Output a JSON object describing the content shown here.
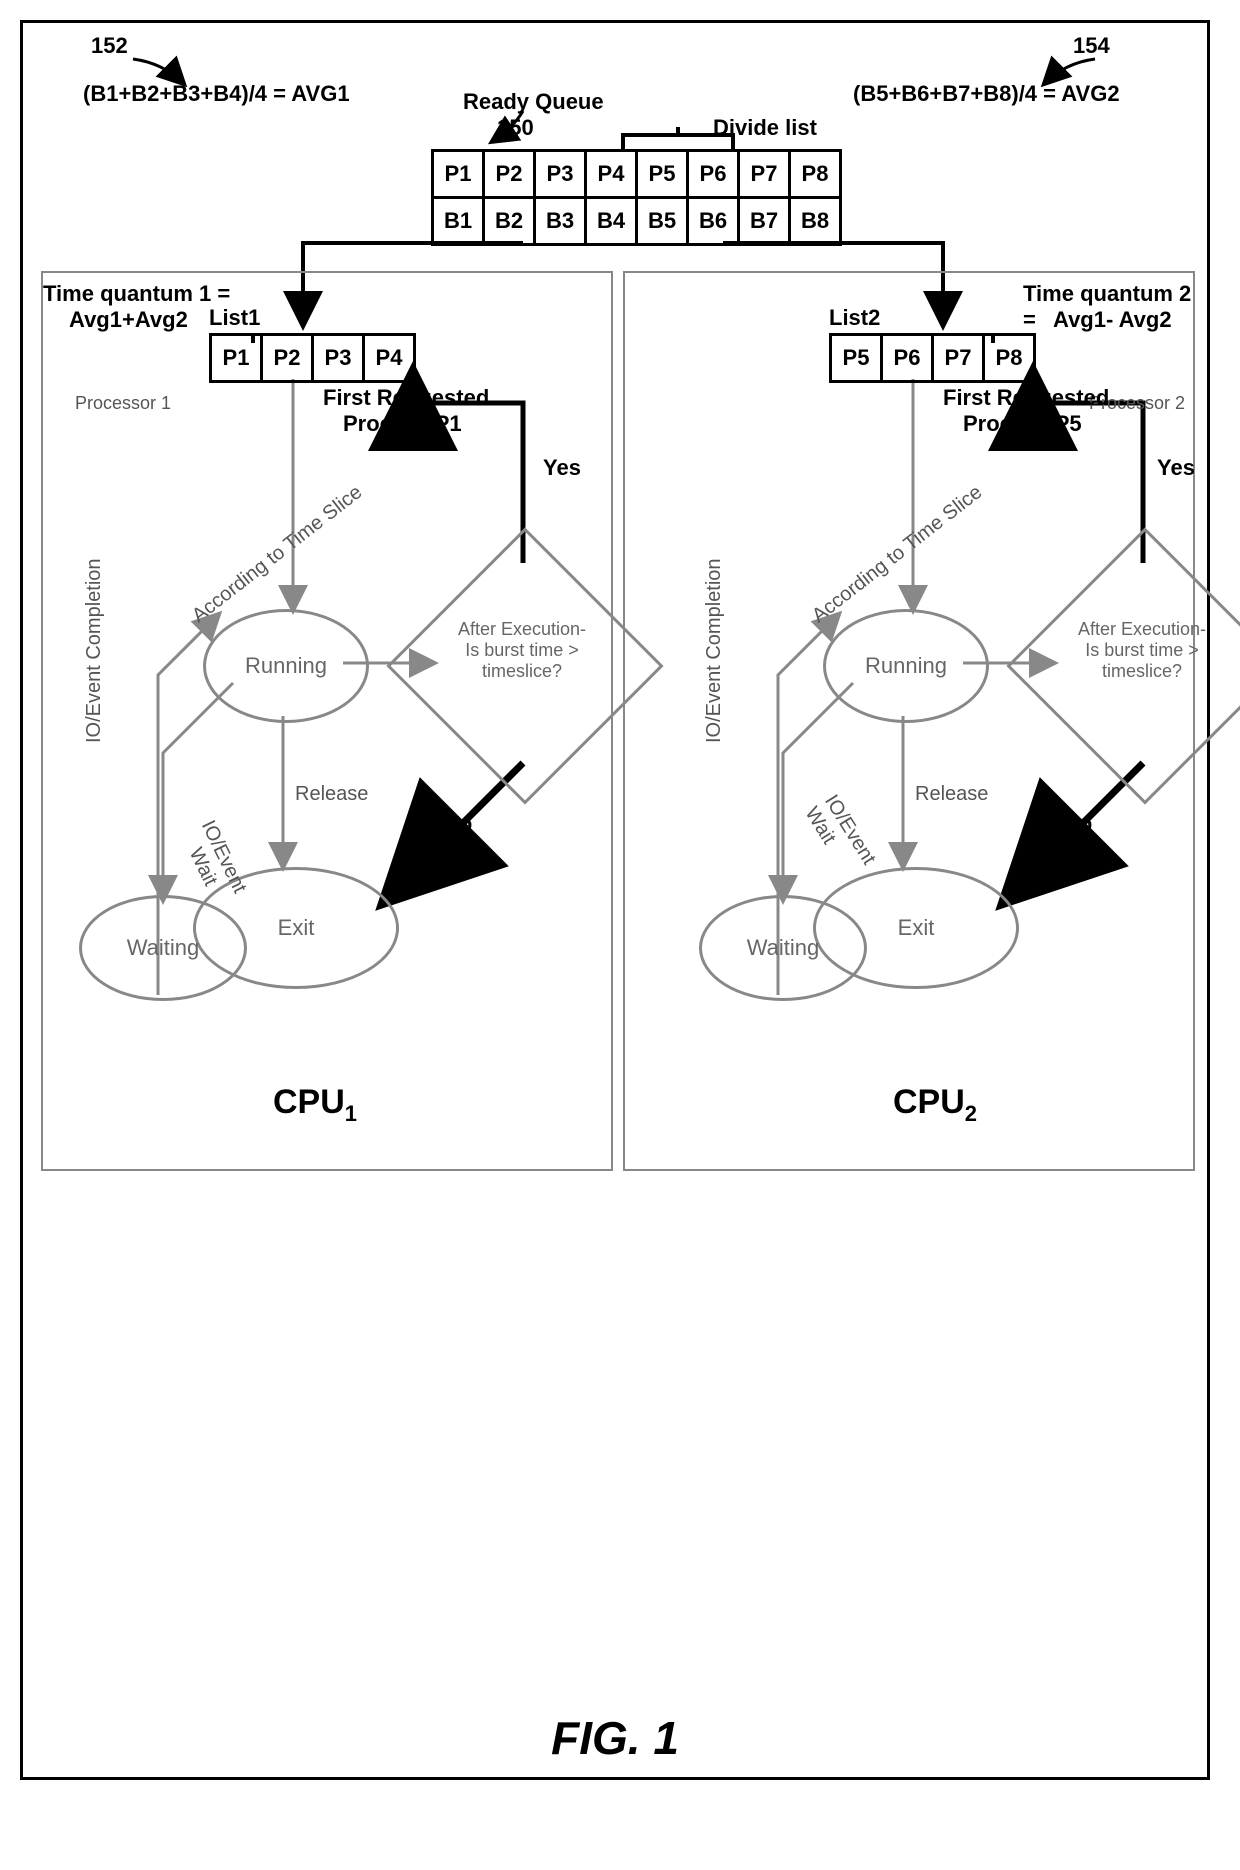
{
  "refs": {
    "r152": "152",
    "r150": "150",
    "r154": "154"
  },
  "top": {
    "avg1_formula": "(B1+B2+B3+B4)/4 = AVG1",
    "avg2_formula": "(B5+B6+B7+B8)/4 = AVG2",
    "ready_queue": "Ready Queue",
    "divide_list": "Divide list"
  },
  "ready_queue": {
    "row1": [
      "P1",
      "P2",
      "P3",
      "P4",
      "P5",
      "P6",
      "P7",
      "P8"
    ],
    "row2": [
      "B1",
      "B2",
      "B3",
      "B4",
      "B5",
      "B6",
      "B7",
      "B8"
    ]
  },
  "list1": {
    "label": "List1",
    "cells": [
      "P1",
      "P2",
      "P3",
      "P4"
    ]
  },
  "list2": {
    "label": "List2",
    "cells": [
      "P5",
      "P6",
      "P7",
      "P8"
    ]
  },
  "tq1": {
    "l1": "Time quantum 1 =",
    "l2": "Avg1+Avg2"
  },
  "tq2": {
    "l1": "Time quantum 2 =",
    "l2": "Avg1- Avg2"
  },
  "first1": {
    "l1": "First Requested",
    "l2": "Process P1"
  },
  "first2": {
    "l1": "First Requested",
    "l2": "Process P5"
  },
  "edges": {
    "timeslice": "According to Time Slice",
    "release": "Release",
    "io_wait": "IO/Event Wait",
    "io_wait_br": "IO/Event\nWait",
    "io_complete": "IO/Event Completion"
  },
  "decision": {
    "l1": "After Execution-",
    "l2": "Is burst time >",
    "l3": "timeslice?",
    "yes": "Yes",
    "no": "No"
  },
  "states": {
    "running": "Running",
    "exit": "Exit",
    "waiting": "Waiting"
  },
  "proc1": "Processor 1",
  "proc2": "Processor 2",
  "cpu1": "CPU",
  "cpu2": "CPU",
  "figure": "FIG. 1"
}
